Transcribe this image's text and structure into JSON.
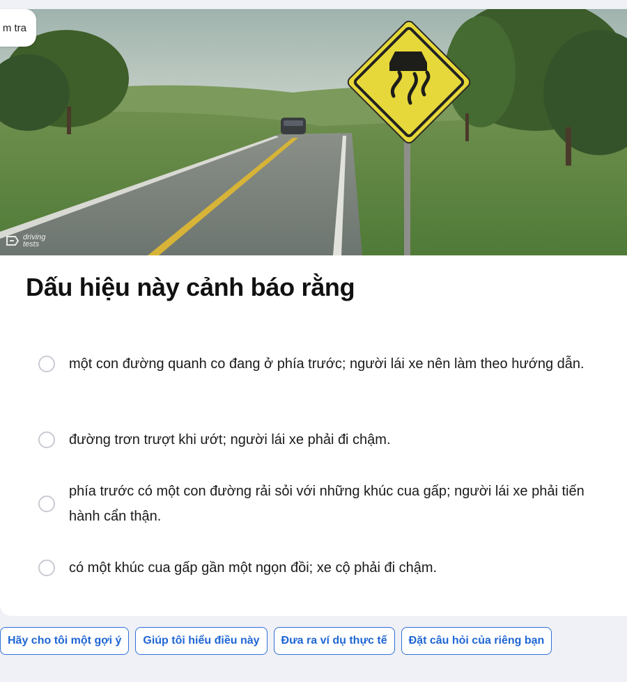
{
  "badge": {
    "label": "m tra"
  },
  "hero": {
    "watermark_line1": "driving",
    "watermark_line2": "tests",
    "sign_icon": "slippery-road-sign"
  },
  "question": {
    "title": "Dấu hiệu này cảnh báo rằng"
  },
  "options": [
    {
      "text": "một con đường quanh co đang ở phía trước; người lái xe nên làm theo hướng dẫn."
    },
    {
      "text": "đường trơn trượt khi ướt; người lái xe phải đi chậm."
    },
    {
      "text": "phía trước có một con đường rải sỏi với những khúc cua gấp; người lái xe phải tiến hành cẩn thận."
    },
    {
      "text": "có một khúc cua gấp gần một ngọn đồi; xe cộ phải đi chậm."
    }
  ],
  "chips": [
    {
      "label": "Hãy cho tôi một gợi ý"
    },
    {
      "label": "Giúp tôi hiểu điều này"
    },
    {
      "label": "Đưa ra ví dụ thực tế"
    },
    {
      "label": "Đặt câu hỏi của riêng bạn"
    }
  ],
  "colors": {
    "accent": "#1f66d4",
    "background": "#f0f1f6",
    "sign_yellow": "#e6d83a"
  }
}
